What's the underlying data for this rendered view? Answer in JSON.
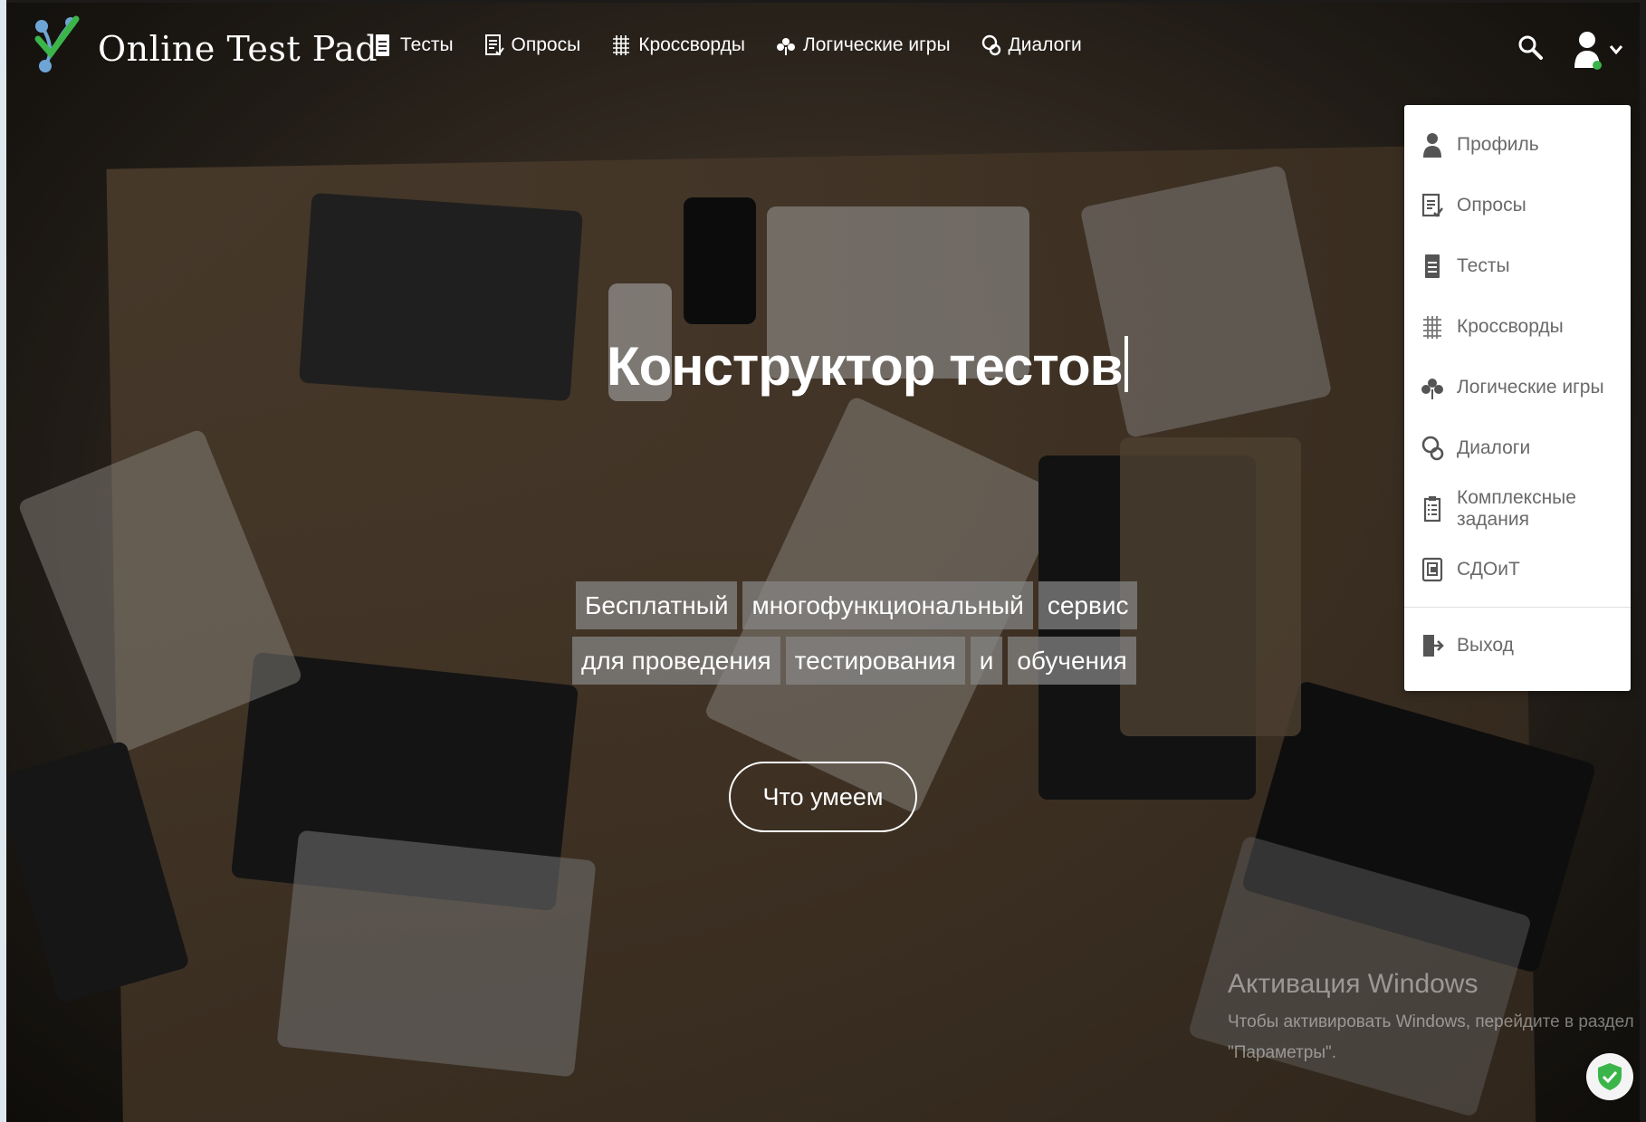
{
  "brand": {
    "name": "Online Test Pad"
  },
  "nav": {
    "items": [
      {
        "label": "Тесты",
        "icon": "test-icon"
      },
      {
        "label": "Опросы",
        "icon": "survey-icon"
      },
      {
        "label": "Кроссворды",
        "icon": "crossword-icon"
      },
      {
        "label": "Логические игры",
        "icon": "logic-game-icon"
      },
      {
        "label": "Диалоги",
        "icon": "dialog-icon"
      }
    ]
  },
  "user_menu": {
    "items": [
      {
        "label": "Профиль",
        "icon": "profile-icon"
      },
      {
        "label": "Опросы",
        "icon": "survey-icon"
      },
      {
        "label": "Тесты",
        "icon": "test-icon"
      },
      {
        "label": "Кроссворды",
        "icon": "crossword-icon"
      },
      {
        "label": "Логические игры",
        "icon": "logic-game-icon"
      },
      {
        "label": "Диалоги",
        "icon": "dialog-icon"
      },
      {
        "label": "Комплексные задания",
        "icon": "complex-task-icon"
      },
      {
        "label": "СДОиТ",
        "icon": "sdoit-icon"
      }
    ],
    "logout_label": "Выход"
  },
  "hero": {
    "title": "Конструктор тестов",
    "tagline_row1": [
      "Бесплатный",
      "многофункциональный",
      "сервис"
    ],
    "tagline_row2": [
      "для проведения",
      "тестирования",
      "и",
      "обучения"
    ],
    "cta_label": "Что умеем"
  },
  "watermark": {
    "heading": "Активация Windows",
    "line1": "Чтобы активировать Windows, перейдите в раздел",
    "line2": "\"Параметры\"."
  },
  "colors": {
    "accent_green": "#3bb54a",
    "menu_text": "#6a6a6a"
  }
}
